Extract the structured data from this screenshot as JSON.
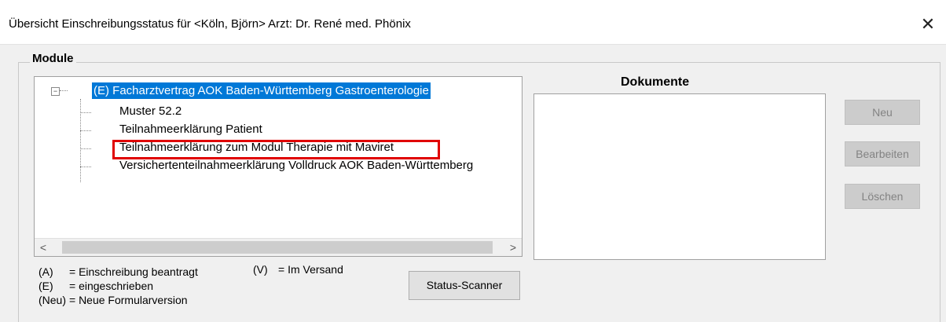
{
  "window": {
    "title": "Übersicht Einschreibungsstatus für <Köln, Björn> Arzt: Dr. René med. Phönix",
    "close_glyph": "✕"
  },
  "module_group": {
    "label": "Module",
    "tree": {
      "root": "(E) Facharztvertrag AOK Baden-Württemberg Gastroenterologie",
      "children": [
        "Muster 52.2",
        "Teilnahmeerklärung Patient",
        "Teilnahmeerklärung zum Modul Therapie mit Maviret",
        "Versichertenteilnahmeerklärung Volldruck AOK Baden-Württemberg"
      ]
    },
    "scroll_left": "<",
    "scroll_right": ">"
  },
  "legend": {
    "a_code": "(A)",
    "a_text": "= Einschreibung beantragt",
    "v_code": "(V)",
    "v_text": "= Im Versand",
    "e_code": "(E)",
    "e_text": "= eingeschrieben",
    "neu_code": "(Neu)",
    "neu_text": "= Neue Formularversion"
  },
  "buttons": {
    "status_scanner": "Status-Scanner",
    "neu": "Neu",
    "bearbeiten": "Bearbeiten",
    "loeschen": "Löschen"
  },
  "documents": {
    "title": "Dokumente"
  },
  "colors": {
    "selection": "#0078d7",
    "highlight_box": "#e00000"
  }
}
